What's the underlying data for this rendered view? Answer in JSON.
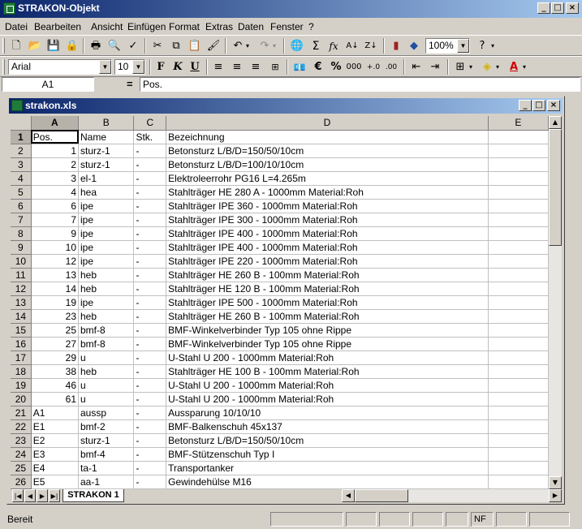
{
  "app": {
    "title": "STRAKON-Objekt"
  },
  "menu": [
    "Datei",
    "Bearbeiten",
    "Ansicht",
    "Einfügen",
    "Format",
    "Extras",
    "Daten",
    "Fenster",
    "?"
  ],
  "toolbar": {
    "zoom": "100%",
    "font": "Arial",
    "font_size": "10",
    "bold": "F",
    "italic": "K",
    "underline": "U",
    "percent": "%",
    "thousands": "000",
    "sum": "Σ",
    "fx": "fx"
  },
  "formula_bar": {
    "cell_ref": "A1",
    "equals": "=",
    "value": "Pos."
  },
  "workbook": {
    "title": "strakon.xls",
    "active_sheet": "STRAKON 1"
  },
  "sheet": {
    "columns": [
      "A",
      "B",
      "C",
      "D",
      "E"
    ],
    "rows": [
      {
        "n": "1",
        "a": "Pos.",
        "b": "Name",
        "c": "Stk.",
        "d": "Bezeichnung"
      },
      {
        "n": "2",
        "a": "1",
        "b": "sturz-1",
        "c": "-",
        "d": "Betonsturz L/B/D=150/50/10cm"
      },
      {
        "n": "3",
        "a": "2",
        "b": "sturz-1",
        "c": "-",
        "d": "Betonsturz L/B/D=100/10/10cm"
      },
      {
        "n": "4",
        "a": "3",
        "b": "el-1",
        "c": "-",
        "d": "Elektroleerrohr PG16 L=4.265m"
      },
      {
        "n": "5",
        "a": "4",
        "b": "hea",
        "c": "-",
        "d": "Stahlträger HE 280 A - 1000mm  Material:Roh"
      },
      {
        "n": "6",
        "a": "6",
        "b": "ipe",
        "c": "-",
        "d": "Stahlträger IPE 360 - 1000mm  Material:Roh"
      },
      {
        "n": "7",
        "a": "7",
        "b": "ipe",
        "c": "-",
        "d": "Stahlträger IPE 300 - 1000mm  Material:Roh"
      },
      {
        "n": "8",
        "a": "9",
        "b": "ipe",
        "c": "-",
        "d": "Stahlträger IPE 400 - 1000mm  Material:Roh"
      },
      {
        "n": "9",
        "a": "10",
        "b": "ipe",
        "c": "-",
        "d": "Stahlträger IPE 400 - 1000mm  Material:Roh"
      },
      {
        "n": "10",
        "a": "12",
        "b": "ipe",
        "c": "-",
        "d": "Stahlträger IPE 220 - 1000mm  Material:Roh"
      },
      {
        "n": "11",
        "a": "13",
        "b": "heb",
        "c": "-",
        "d": "Stahlträger HE 260 B - 100mm  Material:Roh"
      },
      {
        "n": "12",
        "a": "14",
        "b": "heb",
        "c": "-",
        "d": "Stahlträger HE 120 B - 100mm  Material:Roh"
      },
      {
        "n": "13",
        "a": "19",
        "b": "ipe",
        "c": "-",
        "d": "Stahlträger IPE 500 - 1000mm  Material:Roh"
      },
      {
        "n": "14",
        "a": "23",
        "b": "heb",
        "c": "-",
        "d": "Stahlträger HE 260 B - 100mm  Material:Roh"
      },
      {
        "n": "15",
        "a": "25",
        "b": "bmf-8",
        "c": "-",
        "d": "BMF-Winkelverbinder Typ 105 ohne Rippe"
      },
      {
        "n": "16",
        "a": "27",
        "b": "bmf-8",
        "c": "-",
        "d": "BMF-Winkelverbinder Typ 105 ohne Rippe"
      },
      {
        "n": "17",
        "a": "29",
        "b": "u",
        "c": "-",
        "d": "U-Stahl  U 200 - 1000mm  Material:Roh"
      },
      {
        "n": "18",
        "a": "38",
        "b": "heb",
        "c": "-",
        "d": "Stahlträger HE 100 B - 100mm  Material:Roh"
      },
      {
        "n": "19",
        "a": "46",
        "b": "u",
        "c": "-",
        "d": "U-Stahl  U 200 - 1000mm  Material:Roh"
      },
      {
        "n": "20",
        "a": "61",
        "b": "u",
        "c": "-",
        "d": "U-Stahl  U 200 - 1000mm  Material:Roh"
      },
      {
        "n": "21",
        "a": "A1",
        "b": "aussp",
        "c": "-",
        "d": "Aussparung 10/10/10"
      },
      {
        "n": "22",
        "a": "E1",
        "b": "bmf-2",
        "c": "-",
        "d": "BMF-Balkenschuh 45x137"
      },
      {
        "n": "23",
        "a": "E2",
        "b": "sturz-1",
        "c": "-",
        "d": "Betonsturz L/B/D=150/50/10cm"
      },
      {
        "n": "24",
        "a": "E3",
        "b": "bmf-4",
        "c": "-",
        "d": "BMF-Stützenschuh Typ I"
      },
      {
        "n": "25",
        "a": "E4",
        "b": "ta-1",
        "c": "-",
        "d": "Transportanker"
      },
      {
        "n": "26",
        "a": "E5",
        "b": "aa-1",
        "c": "-",
        "d": "Gewindehülse M16"
      }
    ]
  },
  "status": {
    "text": "Bereit",
    "nf": "NF"
  }
}
